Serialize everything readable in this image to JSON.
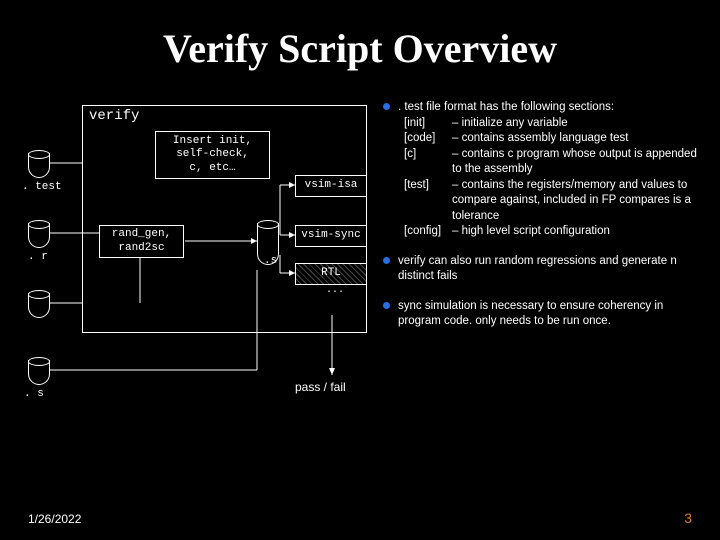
{
  "title": "Verify Script Overview",
  "diagram": {
    "verify_label": "verify",
    "insert_box": "Insert init,\nself-check,\nc, etc…",
    "rand_box": "rand_gen,\nrand2sc",
    "vsim_isa": "vsim-isa",
    "vsim_sync": "vsim-sync",
    "rtl": "RTL",
    "s_mid": ".s",
    "dots": "...",
    "labels": {
      "test": ". test",
      "r": ". r",
      "s": ". s"
    },
    "passfail": "pass / fail"
  },
  "bullets": [
    {
      "intro": ". test file format has the following sections:",
      "sections": [
        {
          "key": "[init]",
          "desc": "– initialize any variable"
        },
        {
          "key": "[code]",
          "desc": "– contains assembly language test"
        },
        {
          "key": "[c]",
          "desc": "– contains c program whose output is appended to the assembly"
        },
        {
          "key": "[test]",
          "desc": "– contains the registers/memory and values to compare against, included in FP compares is a tolerance"
        },
        {
          "key": "[config]",
          "desc": "– high level script configuration"
        }
      ]
    },
    {
      "text": "verify can also run random regressions and generate n distinct fails"
    },
    {
      "text": "sync simulation is necessary to ensure coherency in program code. only needs to be run once."
    }
  ],
  "footer": {
    "date": "1/26/2022",
    "page": "3"
  }
}
